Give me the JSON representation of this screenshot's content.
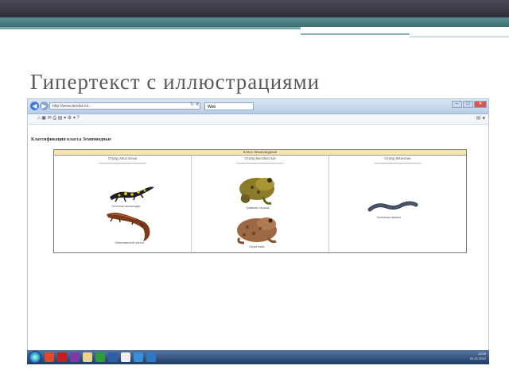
{
  "slide": {
    "title": "Гипертекст с иллюстрациями"
  },
  "browser": {
    "address": "http://www.biodat.ru/...",
    "tab_label": "Web",
    "toolbar_right": "✉ ▾"
  },
  "page": {
    "heading": "Классификация класса Земноводные",
    "table_header": "Класс Земноводные",
    "columns": [
      {
        "title": "Отряд Хвостатые",
        "captions": [
          "Обыкновенный тритон",
          "Огненная саламандра"
        ]
      },
      {
        "title": "Отряд Бесхвостые",
        "captions": [
          "Травяная лягушка",
          "Серая жаба"
        ]
      },
      {
        "title": "Отряд Безногие",
        "captions": [
          "Кольчатая червяга"
        ]
      }
    ]
  },
  "taskbar": {
    "time": "12:00",
    "date": "01.01.2012"
  },
  "colors": {
    "header_dark": "#2f3038",
    "header_teal": "#3e6e70",
    "table_header": "#f7e4b0"
  }
}
